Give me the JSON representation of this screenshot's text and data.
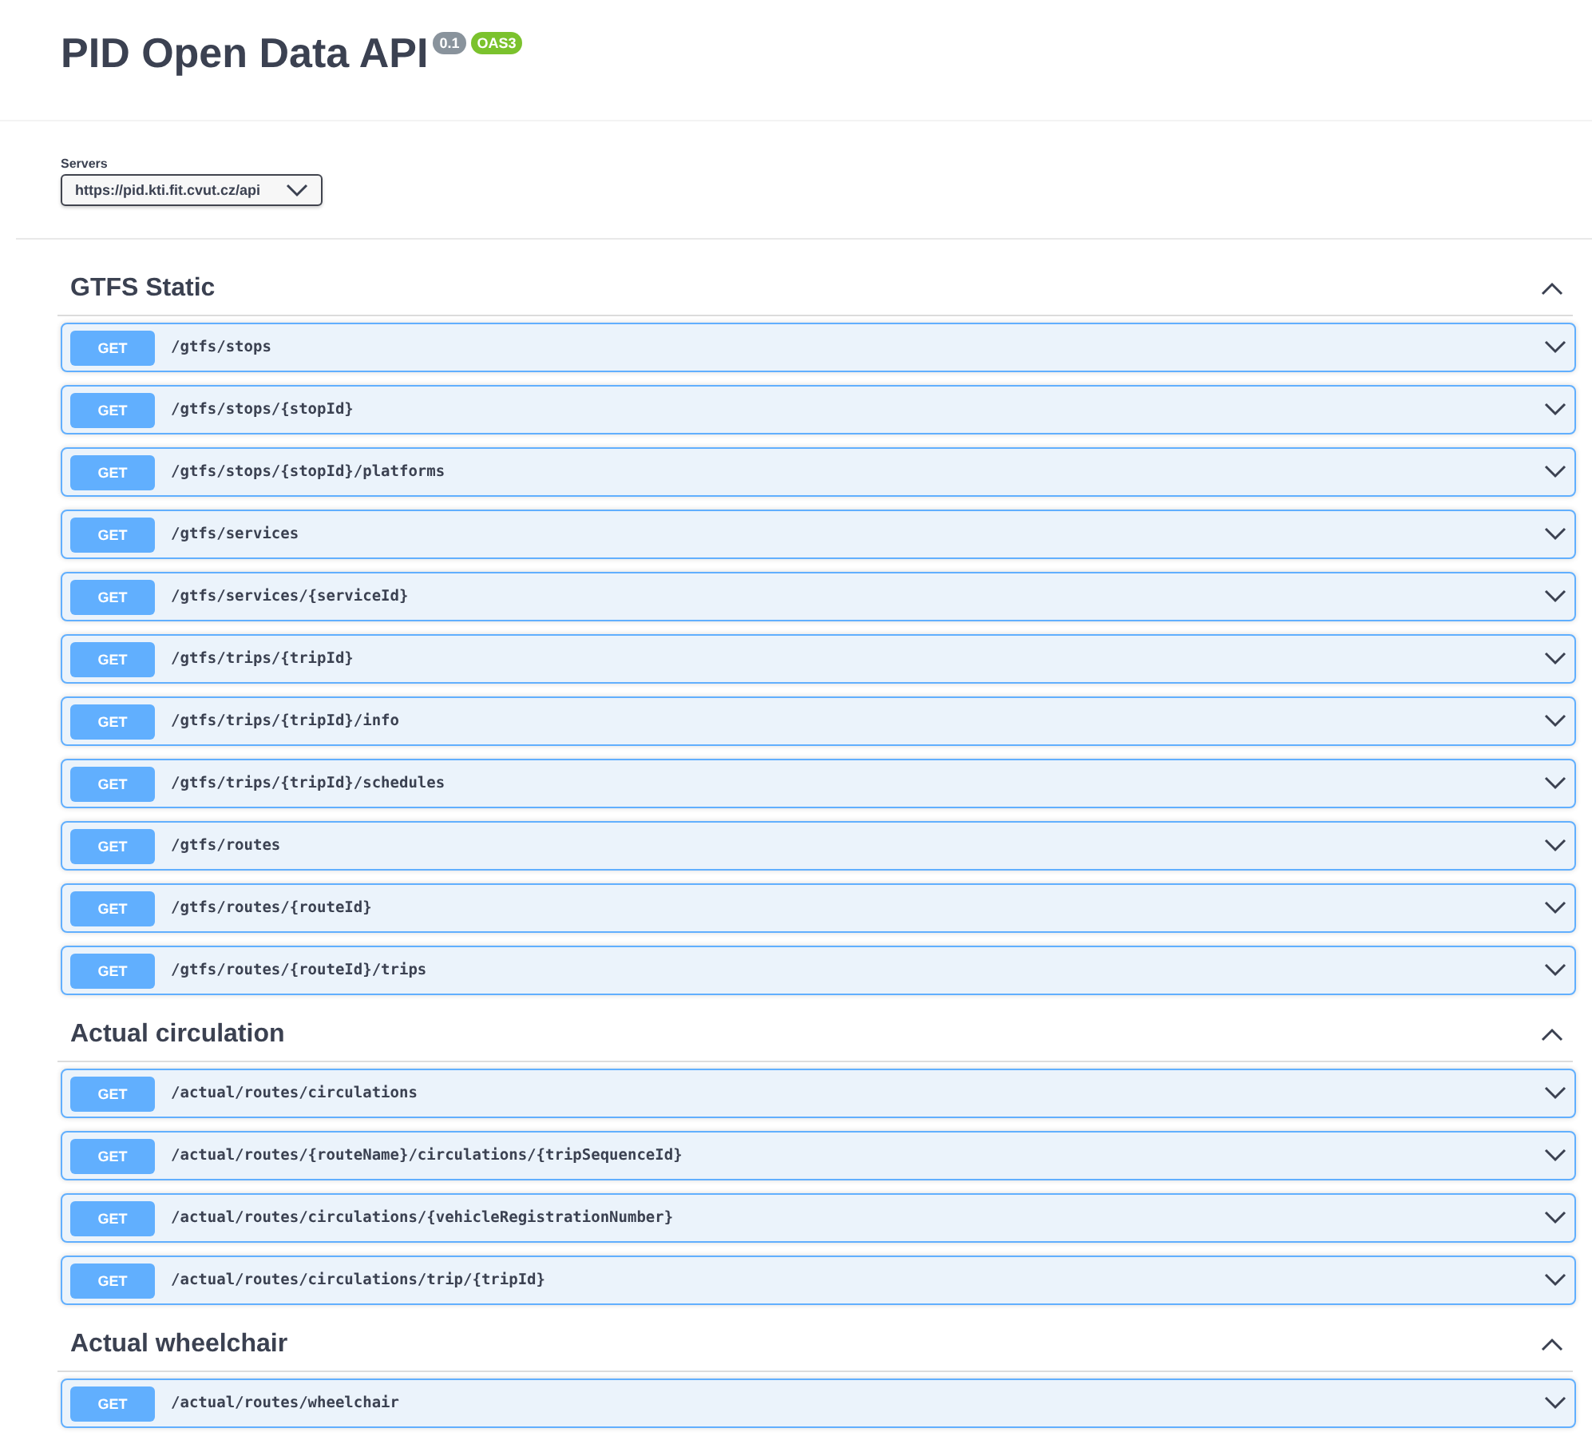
{
  "title": "PID Open Data API",
  "badges": [
    {
      "label": "0.1",
      "color": "#89939c"
    },
    {
      "label": "OAS3",
      "color": "#7bc22d"
    }
  ],
  "servers": {
    "label": "Servers",
    "value": "https://pid.kti.fit.cvut.cz/api"
  },
  "sections": [
    {
      "name": "GTFS Static",
      "expanded": true,
      "operations": [
        {
          "method": "GET",
          "path": "/gtfs/stops",
          "expanded": false
        },
        {
          "method": "GET",
          "path": "/gtfs/stops/{stopId}",
          "expanded": false
        },
        {
          "method": "GET",
          "path": "/gtfs/stops/{stopId}/platforms",
          "expanded": false
        },
        {
          "method": "GET",
          "path": "/gtfs/services",
          "expanded": false
        },
        {
          "method": "GET",
          "path": "/gtfs/services/{serviceId}",
          "expanded": false
        },
        {
          "method": "GET",
          "path": "/gtfs/trips/{tripId}",
          "expanded": false
        },
        {
          "method": "GET",
          "path": "/gtfs/trips/{tripId}/info",
          "expanded": false
        },
        {
          "method": "GET",
          "path": "/gtfs/trips/{tripId}/schedules",
          "expanded": false
        },
        {
          "method": "GET",
          "path": "/gtfs/routes",
          "expanded": false
        },
        {
          "method": "GET",
          "path": "/gtfs/routes/{routeId}",
          "expanded": false
        },
        {
          "method": "GET",
          "path": "/gtfs/routes/{routeId}/trips",
          "expanded": false
        }
      ]
    },
    {
      "name": "Actual circulation",
      "expanded": true,
      "operations": [
        {
          "method": "GET",
          "path": "/actual/routes/circulations",
          "expanded": false
        },
        {
          "method": "GET",
          "path": "/actual/routes/{routeName}/circulations/{tripSequenceId}",
          "expanded": false
        },
        {
          "method": "GET",
          "path": "/actual/routes/circulations/{vehicleRegistrationNumber}",
          "expanded": false
        },
        {
          "method": "GET",
          "path": "/actual/routes/circulations/trip/{tripId}",
          "expanded": false
        }
      ]
    },
    {
      "name": "Actual wheelchair",
      "expanded": true,
      "operations": [
        {
          "method": "GET",
          "path": "/actual/routes/wheelchair",
          "expanded": false
        }
      ]
    }
  ]
}
